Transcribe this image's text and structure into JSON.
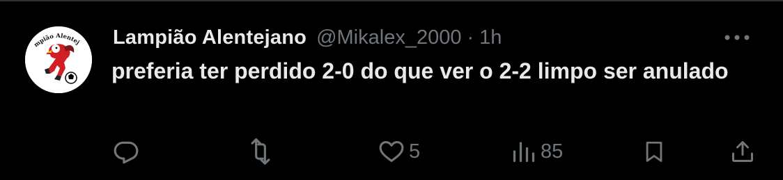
{
  "tweet": {
    "display_name": "Lampião Alentejano",
    "handle": "@Mikalex_2000",
    "separator": "·",
    "time": "1h",
    "text": "preferia ter perdido 2-0 do que ver o 2-2 limpo ser anulado",
    "avatar_text": "Lampião Alentejano"
  },
  "actions": {
    "reply_icon": "reply-icon",
    "retweet_icon": "retweet-icon",
    "like_icon": "heart-icon",
    "like_count": "5",
    "views_icon": "views-icon",
    "views_count": "85",
    "bookmark_icon": "bookmark-icon",
    "share_icon": "share-icon"
  },
  "colors": {
    "background": "#000000",
    "text": "#e7e9ea",
    "secondary": "#71767b",
    "border": "#2f3336"
  }
}
